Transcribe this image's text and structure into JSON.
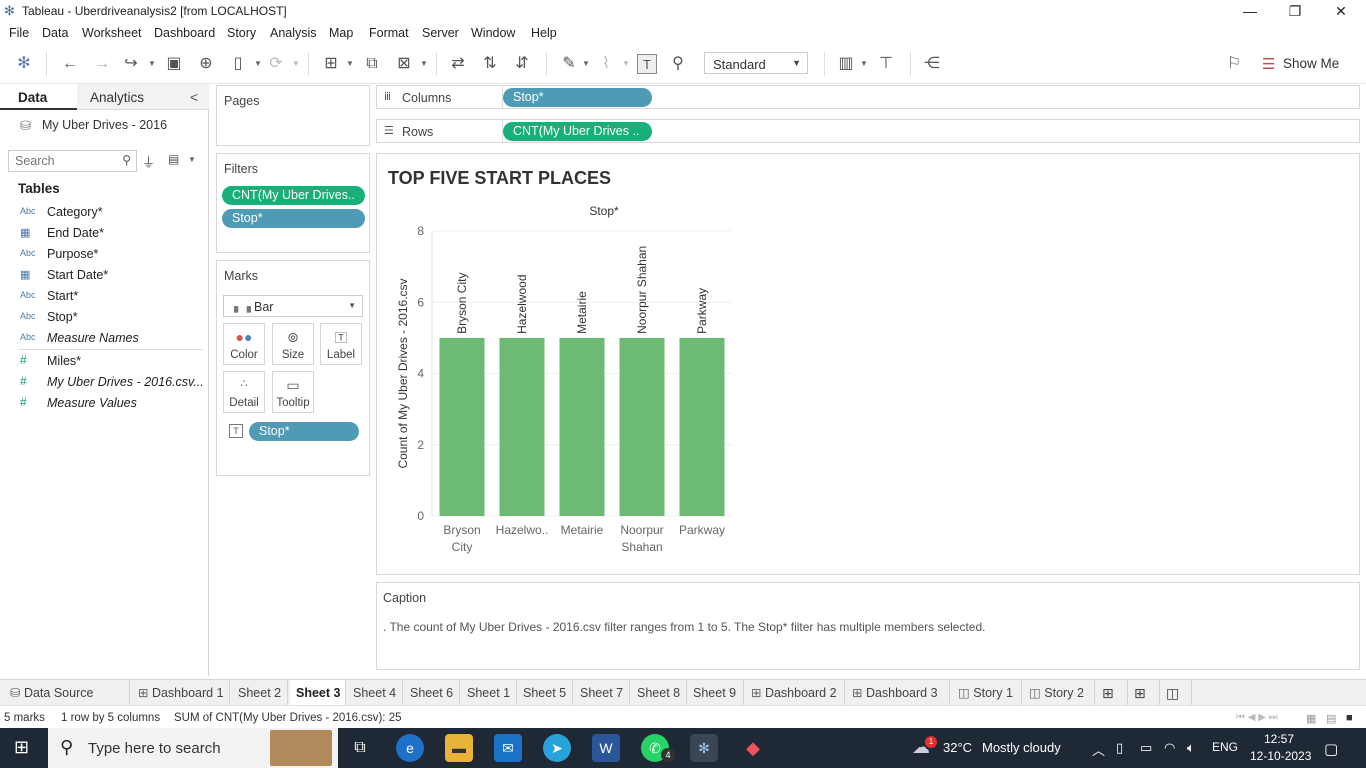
{
  "window": {
    "title": "Tableau - Uberdriveanalysis2 [from LOCALHOST]",
    "minimize": "—",
    "restore": "❐",
    "close": "✕"
  },
  "menu": [
    "File",
    "Data",
    "Worksheet",
    "Dashboard",
    "Story",
    "Analysis",
    "Map",
    "Format",
    "Server",
    "Window",
    "Help"
  ],
  "toolbar": {
    "fit_value": "Standard",
    "show_me_label": "Show Me"
  },
  "data_pane": {
    "tab_data": "Data",
    "tab_analytics": "Analytics",
    "collapse": "<",
    "datasource": "My Uber Drives - 2016",
    "search_placeholder": "Search",
    "tables_header": "Tables",
    "fields": [
      {
        "type": "Abc",
        "name": "Category*",
        "italic": false
      },
      {
        "type": "date",
        "name": "End Date*",
        "italic": false
      },
      {
        "type": "Abc",
        "name": "Purpose*",
        "italic": false
      },
      {
        "type": "date",
        "name": "Start Date*",
        "italic": false
      },
      {
        "type": "Abc",
        "name": "Start*",
        "italic": false
      },
      {
        "type": "Abc",
        "name": "Stop*",
        "italic": false
      },
      {
        "type": "Abc",
        "name": "Measure Names",
        "italic": true
      },
      {
        "type": "#",
        "name": "Miles*",
        "italic": false
      },
      {
        "type": "#",
        "name": "My Uber Drives - 2016.csv...",
        "italic": true
      },
      {
        "type": "#",
        "name": "Measure Values",
        "italic": true
      }
    ]
  },
  "cards": {
    "pages_title": "Pages",
    "filters_title": "Filters",
    "filter_pills": [
      "CNT(My Uber Drives..",
      "Stop*"
    ],
    "marks_title": "Marks",
    "mark_type": "Bar",
    "mark_buttons": [
      "Color",
      "Size",
      "Label",
      "Detail",
      "Tooltip"
    ],
    "mark_pill": "Stop*"
  },
  "shelves": {
    "columns_label": "Columns",
    "columns_pill": "Stop*",
    "rows_label": "Rows",
    "rows_pill": "CNT(My Uber Drives .."
  },
  "chart_data": {
    "type": "bar",
    "title": "TOP FIVE START PLACES",
    "xlabel": "Stop*",
    "ylabel": "Count of My Uber Drives - 2016.csv",
    "categories": [
      "Bryson City",
      "Hazelwood",
      "Metairie",
      "Noorpur Shahan",
      "Parkway"
    ],
    "category_tick_labels": [
      [
        "Bryson",
        "City"
      ],
      [
        "Hazelwo.."
      ],
      [
        "Metairie"
      ],
      [
        "Noorpur",
        "Shahan"
      ],
      [
        "Parkway"
      ]
    ],
    "values": [
      5,
      5,
      5,
      5,
      5
    ],
    "ylim": [
      0,
      8
    ],
    "yticks": [
      0,
      2,
      4,
      6,
      8
    ],
    "bar_color": "#6dba75",
    "grid": true
  },
  "caption": {
    "title": "Caption",
    "text": ". The count of My Uber Drives - 2016.csv filter ranges from 1 to 5. The Stop* filter has multiple members selected."
  },
  "sheet_tabs": [
    {
      "label": "Data Source",
      "icon": "datasource",
      "active": false
    },
    {
      "label": "Dashboard 1",
      "icon": "dashboard",
      "active": false
    },
    {
      "label": "Sheet 2",
      "icon": "",
      "active": false
    },
    {
      "label": "Sheet 3",
      "icon": "",
      "active": true
    },
    {
      "label": "Sheet 4",
      "icon": "",
      "active": false
    },
    {
      "label": "Sheet 6",
      "icon": "",
      "active": false
    },
    {
      "label": "Sheet 1",
      "icon": "",
      "active": false
    },
    {
      "label": "Sheet 5",
      "icon": "",
      "active": false
    },
    {
      "label": "Sheet 7",
      "icon": "",
      "active": false
    },
    {
      "label": "Sheet 8",
      "icon": "",
      "active": false
    },
    {
      "label": "Sheet 9",
      "icon": "",
      "active": false
    },
    {
      "label": "Dashboard 2",
      "icon": "dashboard",
      "active": false
    },
    {
      "label": "Dashboard 3",
      "icon": "dashboard",
      "active": false
    },
    {
      "label": "Story 1",
      "icon": "story",
      "active": false
    },
    {
      "label": "Story 2",
      "icon": "story",
      "active": false
    }
  ],
  "status": {
    "marks": "5 marks",
    "layout": "1 row by 5 columns",
    "sum": "SUM of CNT(My Uber Drives - 2016.csv): 25"
  },
  "taskbar": {
    "search_placeholder": "Type here to search",
    "weather_temp": "32°C",
    "weather_text": "Mostly cloudy",
    "language": "ENG",
    "time": "12:57",
    "date": "12-10-2023",
    "weather_badge": "1",
    "whatsapp_badge": "4"
  }
}
